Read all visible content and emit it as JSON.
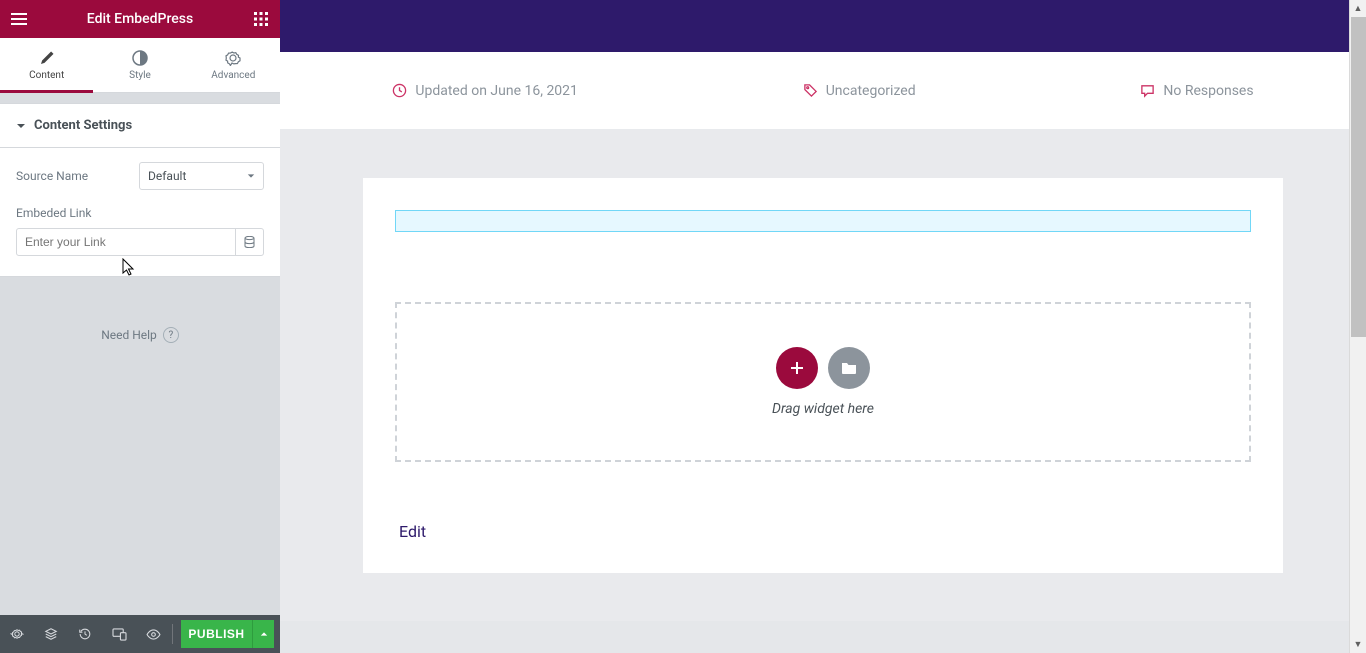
{
  "panel": {
    "title": "Edit EmbedPress",
    "tabs": {
      "content": "Content",
      "style": "Style",
      "advanced": "Advanced"
    },
    "section_title": "Content Settings",
    "fields": {
      "source_name_label": "Source Name",
      "source_name_value": "Default",
      "embed_link_label": "Embeded Link",
      "embed_link_placeholder": "Enter your Link"
    },
    "help": "Need Help",
    "publish": "Publish"
  },
  "meta": {
    "updated_prefix": "Updated on ",
    "updated_date": "June 16, 2021",
    "category": "Uncategorized",
    "responses": "No Responses"
  },
  "dropzone": {
    "text": "Drag widget here"
  },
  "edit_link": "Edit",
  "colors": {
    "accent": "#9b0a3d",
    "header_purple": "#2e1a6b",
    "success": "#39b54a"
  }
}
